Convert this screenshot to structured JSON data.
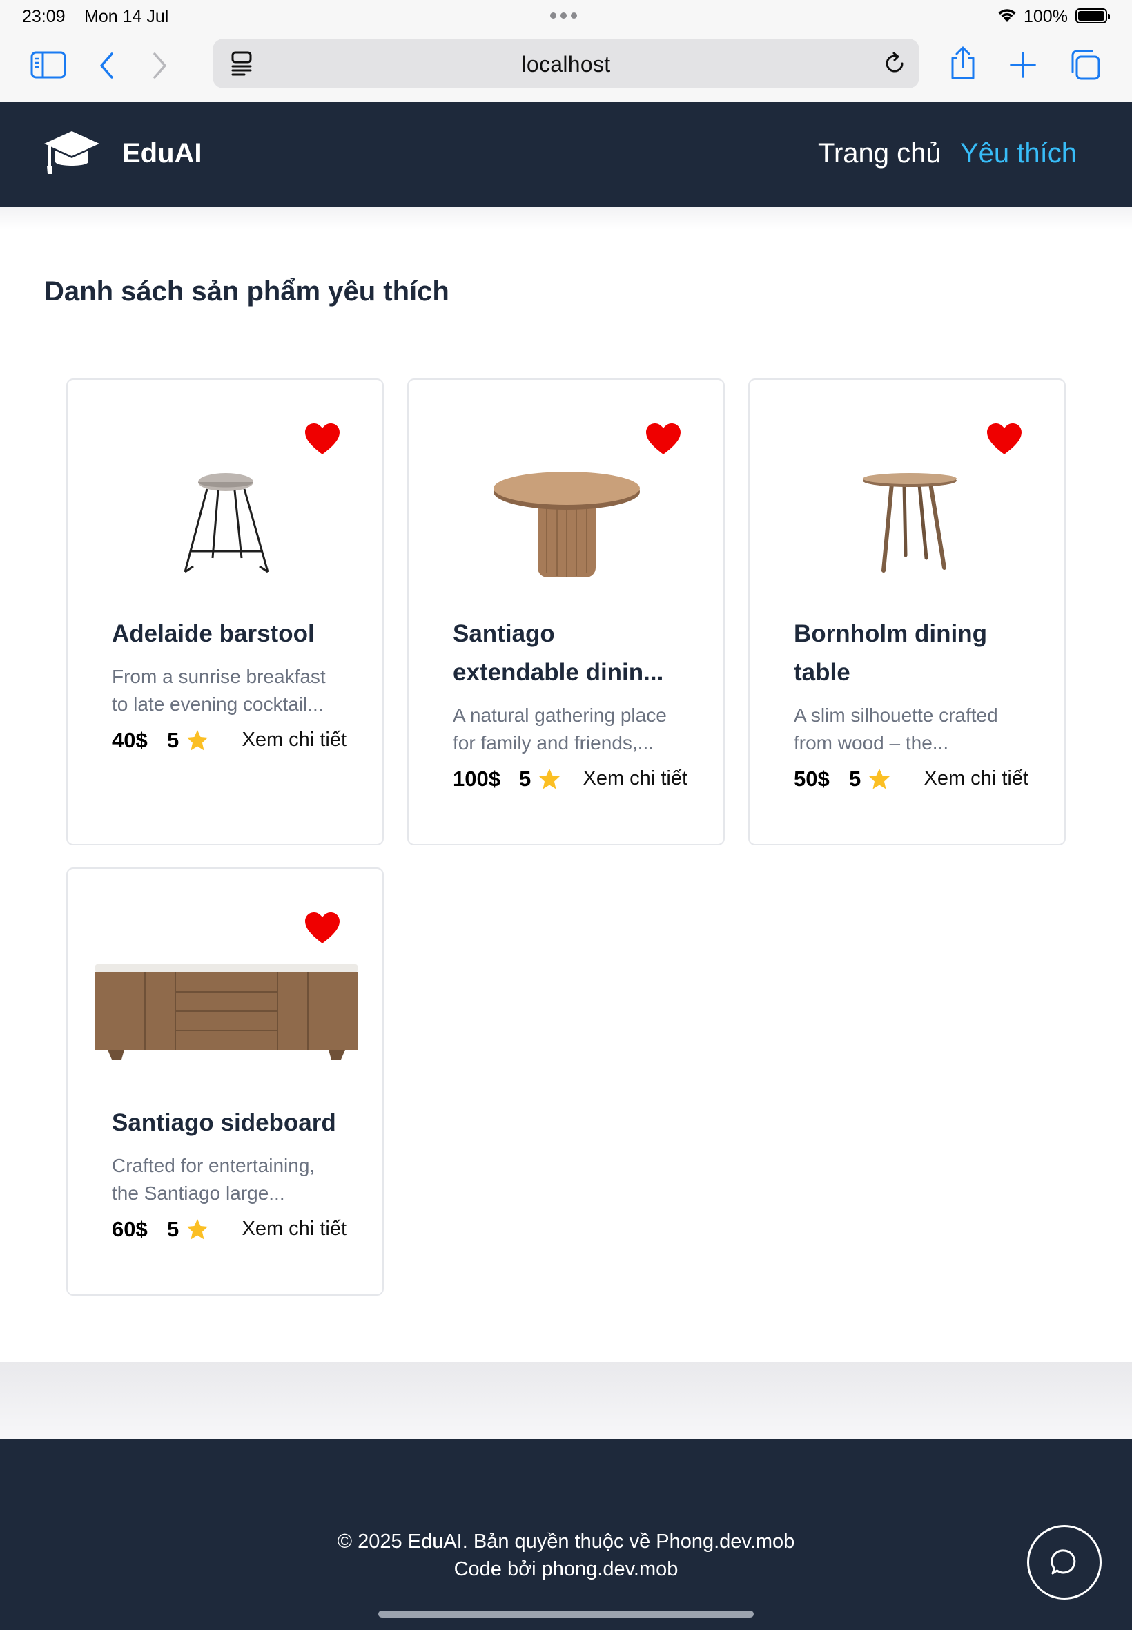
{
  "status_bar": {
    "time": "23:09",
    "date": "Mon 14 Jul",
    "battery": "100%"
  },
  "browser": {
    "url": "localhost",
    "icons": [
      "sidebar-icon",
      "back-icon",
      "forward-icon",
      "page-menu-icon",
      "reload-icon",
      "share-icon",
      "new-tab-icon",
      "tabs-icon"
    ]
  },
  "header": {
    "brand": "EduAI",
    "logo_icon": "graduation-cap-icon",
    "nav": {
      "home": "Trang chủ",
      "favorites": "Yêu thích"
    },
    "active_color": "#38bdf8",
    "background": "#1e293b"
  },
  "main": {
    "title": "Danh sách sản phẩm yêu thích",
    "products": [
      {
        "name": "Adelaide barstool",
        "description_line1": "From a sunrise breakfast",
        "description_line2": "to late evening cocktail...",
        "price": "40$",
        "rating": "5",
        "detail_label": "Xem chi tiết",
        "favorite": true
      },
      {
        "name_line1": "Santiago",
        "name_line2": "extendable dinin...",
        "description_line1": "A natural gathering place",
        "description_line2": "for family and friends,...",
        "price": "100$",
        "rating": "5",
        "detail_label": "Xem chi tiết",
        "favorite": true
      },
      {
        "name_line1": "Bornholm dining",
        "name_line2": "table",
        "description_line1": "A slim silhouette crafted",
        "description_line2": "from wood – the...",
        "price": "50$",
        "rating": "5",
        "detail_label": "Xem chi tiết",
        "favorite": true
      },
      {
        "name": "Santiago sideboard",
        "description_line1": "Crafted for entertaining,",
        "description_line2": "the Santiago large...",
        "price": "60$",
        "rating": "5",
        "detail_label": "Xem chi tiết",
        "favorite": true
      }
    ],
    "heart_color": "#ef0000",
    "star_color": "#fbbf24"
  },
  "footer": {
    "copyright": "© 2025 EduAI. Bản quyền thuộc về Phong.dev.mob",
    "credit": "Code bởi phong.dev.mob",
    "chat_icon": "chat-bubble-icon"
  }
}
